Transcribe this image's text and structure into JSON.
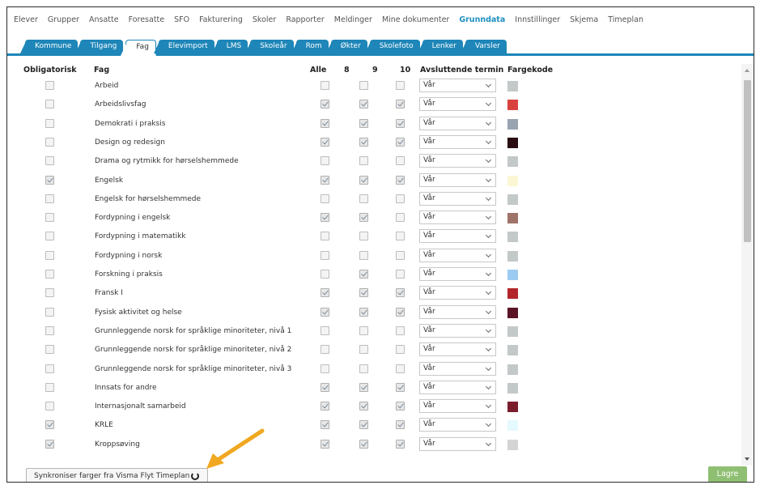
{
  "topnav": {
    "items": [
      {
        "label": "Elever",
        "active": false
      },
      {
        "label": "Grupper",
        "active": false
      },
      {
        "label": "Ansatte",
        "active": false
      },
      {
        "label": "Foresatte",
        "active": false
      },
      {
        "label": "SFO",
        "active": false
      },
      {
        "label": "Fakturering",
        "active": false
      },
      {
        "label": "Skoler",
        "active": false
      },
      {
        "label": "Rapporter",
        "active": false
      },
      {
        "label": "Meldinger",
        "active": false
      },
      {
        "label": "Mine dokumenter",
        "active": false
      },
      {
        "label": "Grunndata",
        "active": true
      },
      {
        "label": "Innstillinger",
        "active": false
      },
      {
        "label": "Skjema",
        "active": false
      },
      {
        "label": "Timeplan",
        "active": false
      }
    ]
  },
  "tabs": [
    {
      "label": "Kommune",
      "active": false
    },
    {
      "label": "Tilgang",
      "active": false
    },
    {
      "label": "Fag",
      "active": true
    },
    {
      "label": "Elevimport",
      "active": false
    },
    {
      "label": "LMS",
      "active": false
    },
    {
      "label": "Skoleår",
      "active": false
    },
    {
      "label": "Rom",
      "active": false
    },
    {
      "label": "Økter",
      "active": false
    },
    {
      "label": "Skolefoto",
      "active": false
    },
    {
      "label": "Lenker",
      "active": false
    },
    {
      "label": "Varsler",
      "active": false
    }
  ],
  "table": {
    "headers": {
      "obligatorisk": "Obligatorisk",
      "fag": "Fag",
      "alle": "Alle",
      "g8": "8",
      "g9": "9",
      "g10": "10",
      "termin": "Avsluttende termin",
      "farge": "Fargekode"
    },
    "rows": [
      {
        "obligatorisk": false,
        "fag": "Arbeid",
        "alle": false,
        "g8": false,
        "g9": false,
        "g10": false,
        "termin": "Vår",
        "farge": "#c3c8c8"
      },
      {
        "obligatorisk": false,
        "fag": "Arbeidslivsfag",
        "alle": true,
        "g8": true,
        "g9": true,
        "g10": true,
        "termin": "Vår",
        "farge": "#d9413f"
      },
      {
        "obligatorisk": false,
        "fag": "Demokrati i praksis",
        "alle": true,
        "g8": true,
        "g9": true,
        "g10": true,
        "termin": "Vår",
        "farge": "#98a4b0"
      },
      {
        "obligatorisk": false,
        "fag": "Design og redesign",
        "alle": true,
        "g8": true,
        "g9": true,
        "g10": true,
        "termin": "Vår",
        "farge": "#2a0d10"
      },
      {
        "obligatorisk": false,
        "fag": "Drama og rytmikk for hørselshemmede",
        "alle": false,
        "g8": false,
        "g9": false,
        "g10": false,
        "termin": "Vår",
        "farge": "#c3c8c8"
      },
      {
        "obligatorisk": true,
        "fag": "Engelsk",
        "alle": true,
        "g8": true,
        "g9": true,
        "g10": true,
        "termin": "Vår",
        "farge": "#fbf7d4"
      },
      {
        "obligatorisk": false,
        "fag": "Engelsk for hørselshemmede",
        "alle": false,
        "g8": false,
        "g9": false,
        "g10": false,
        "termin": "Vår",
        "farge": "#c3c8c8"
      },
      {
        "obligatorisk": false,
        "fag": "Fordypning i engelsk",
        "alle": true,
        "g8": true,
        "g9": false,
        "g10": true,
        "termin": "Vår",
        "farge": "#a0736a"
      },
      {
        "obligatorisk": false,
        "fag": "Fordypning i matematikk",
        "alle": false,
        "g8": false,
        "g9": false,
        "g10": false,
        "termin": "Vår",
        "farge": "#c3c8c8"
      },
      {
        "obligatorisk": false,
        "fag": "Fordypning i norsk",
        "alle": false,
        "g8": false,
        "g9": false,
        "g10": false,
        "termin": "Vår",
        "farge": "#c3c8c8"
      },
      {
        "obligatorisk": false,
        "fag": "Forskning i praksis",
        "alle": false,
        "g8": true,
        "g9": false,
        "g10": true,
        "termin": "Vår",
        "farge": "#9ccbf2"
      },
      {
        "obligatorisk": false,
        "fag": "Fransk I",
        "alle": true,
        "g8": true,
        "g9": true,
        "g10": true,
        "termin": "Vår",
        "farge": "#b3262c"
      },
      {
        "obligatorisk": false,
        "fag": "Fysisk aktivitet og helse",
        "alle": true,
        "g8": true,
        "g9": true,
        "g10": true,
        "termin": "Vår",
        "farge": "#5a1426"
      },
      {
        "obligatorisk": false,
        "fag": "Grunnleggende norsk for språklige minoriteter, nivå 1",
        "alle": false,
        "g8": false,
        "g9": false,
        "g10": false,
        "termin": "Vår",
        "farge": "#c3c8c8"
      },
      {
        "obligatorisk": false,
        "fag": "Grunnleggende norsk for språklige minoriteter, nivå 2",
        "alle": false,
        "g8": false,
        "g9": false,
        "g10": false,
        "termin": "Vår",
        "farge": "#c3c8c8"
      },
      {
        "obligatorisk": false,
        "fag": "Grunnleggende norsk for språklige minoriteter, nivå 3",
        "alle": false,
        "g8": false,
        "g9": false,
        "g10": false,
        "termin": "Vår",
        "farge": "#c3c8c8"
      },
      {
        "obligatorisk": false,
        "fag": "Innsats for andre",
        "alle": true,
        "g8": true,
        "g9": true,
        "g10": true,
        "termin": "Vår",
        "farge": "#c3c8c8"
      },
      {
        "obligatorisk": false,
        "fag": "Internasjonalt samarbeid",
        "alle": true,
        "g8": true,
        "g9": true,
        "g10": true,
        "termin": "Vår",
        "farge": "#7a1e2c"
      },
      {
        "obligatorisk": true,
        "fag": "KRLE",
        "alle": true,
        "g8": true,
        "g9": true,
        "g10": true,
        "termin": "Vår",
        "farge": "#e4faff"
      },
      {
        "obligatorisk": true,
        "fag": "Kroppsøving",
        "alle": true,
        "g8": true,
        "g9": true,
        "g10": true,
        "termin": "Vår",
        "farge": "#d4d4d4"
      }
    ]
  },
  "footer": {
    "sync_label": "Synkroniser farger fra Visma Flyt Timeplan",
    "save_label": "Lagre"
  },
  "colors": {
    "accent": "#1e86b8",
    "active_nav": "#1d8fc0",
    "save": "#8fbf73",
    "arrow": "#f0a820"
  },
  "icons": {
    "sync": "refresh-icon",
    "select_chevron": "chevron-down-icon"
  }
}
